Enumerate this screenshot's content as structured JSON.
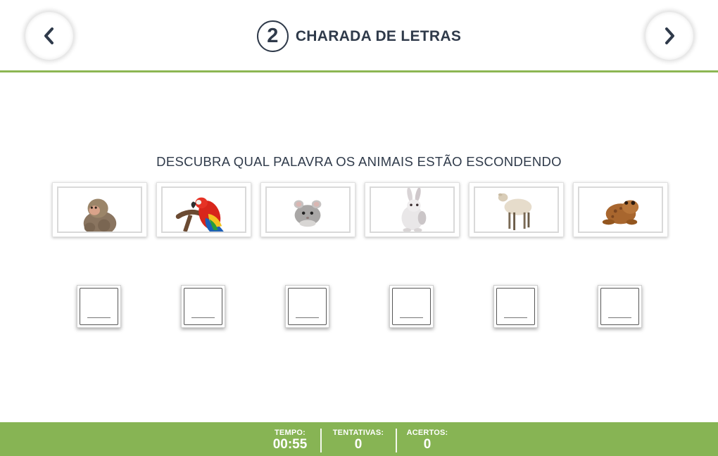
{
  "header": {
    "step_number": "2",
    "title": "CHARADA DE LETRAS",
    "prev_icon": "chevron-left-icon",
    "next_icon": "chevron-right-icon"
  },
  "game": {
    "instruction": "DESCUBRA QUAL PALAVRA OS ANIMAIS ESTÃO ESCONDENDO",
    "animals": [
      {
        "name": "macaco",
        "icon": "monkey-image"
      },
      {
        "name": "arara",
        "icon": "parrot-image"
      },
      {
        "name": "chinchila",
        "icon": "chinchilla-image"
      },
      {
        "name": "coelho",
        "icon": "rabbit-image"
      },
      {
        "name": "ovelha",
        "icon": "sheep-image"
      },
      {
        "name": "sapo",
        "icon": "toad-image"
      }
    ],
    "slots": [
      "",
      "",
      "",
      "",
      "",
      ""
    ]
  },
  "footer": {
    "time_label": "TEMPO:",
    "time_value": "00:55",
    "attempts_label": "TENTATIVAS:",
    "attempts_value": "0",
    "hits_label": "ACERTOS:",
    "hits_value": "0"
  },
  "colors": {
    "accent_green": "#87b454",
    "text_dark": "#2f3a4a"
  }
}
